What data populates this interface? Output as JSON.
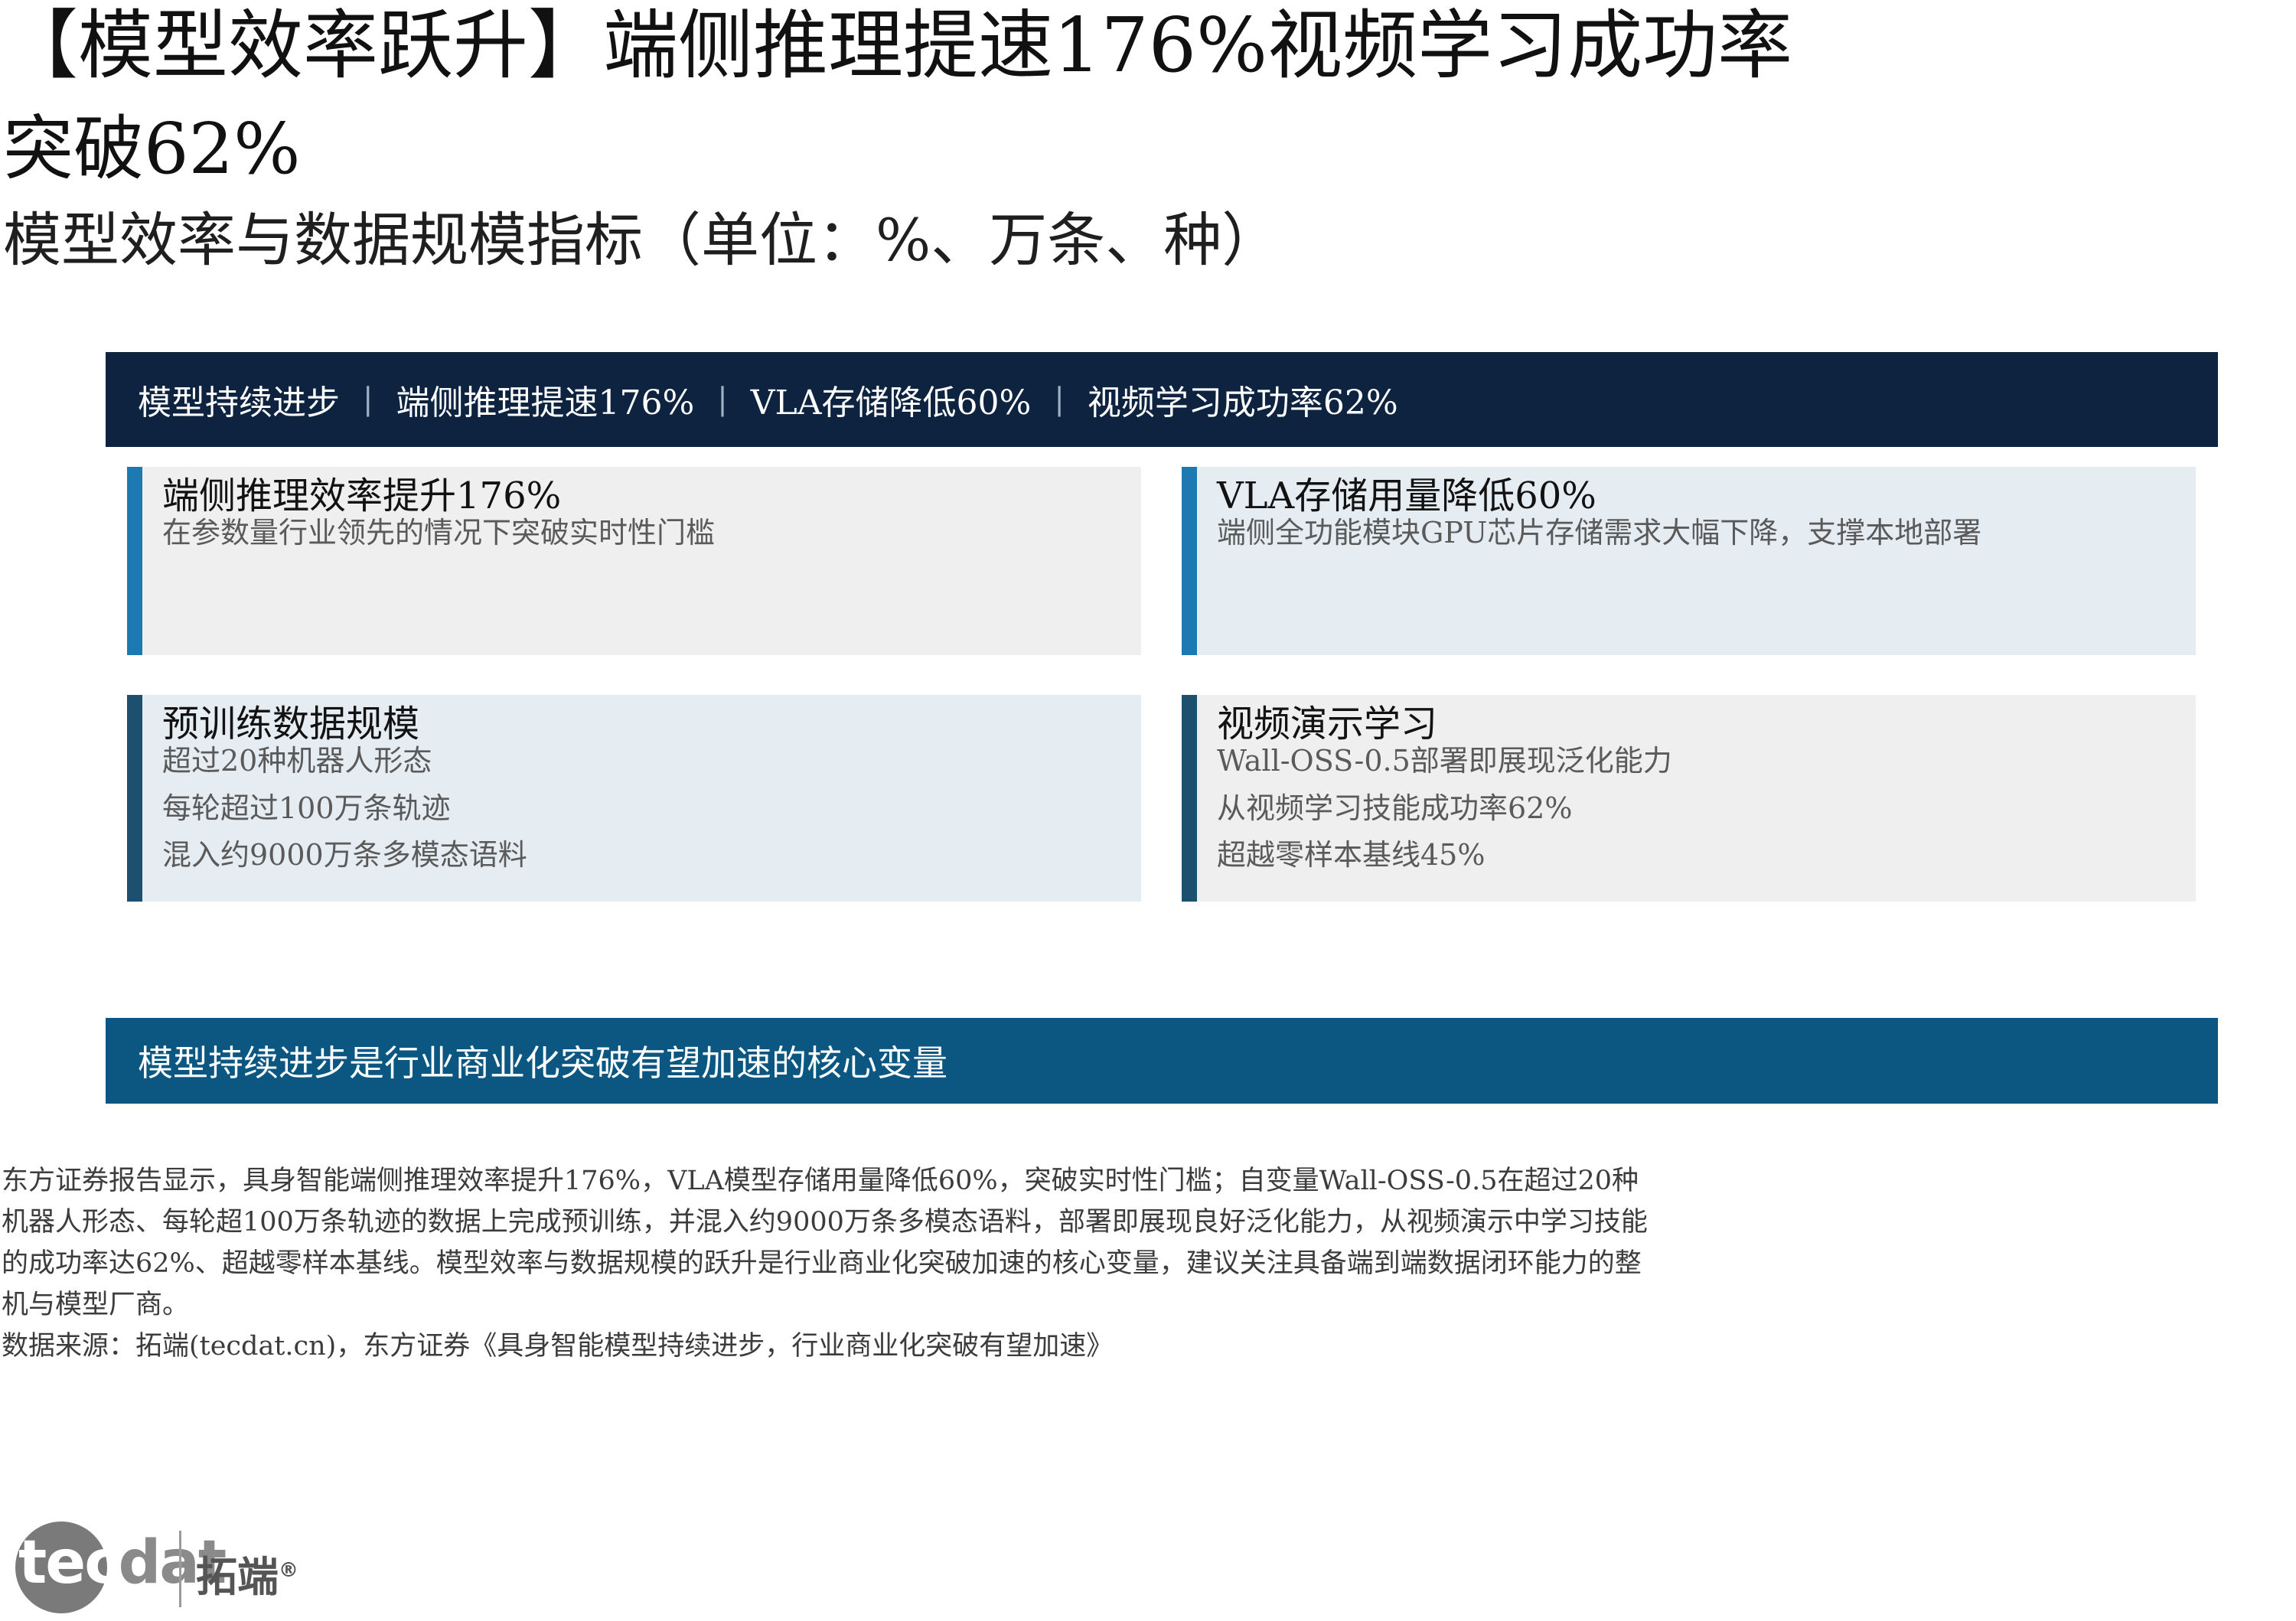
{
  "title_line1": "【模型效率跃升】端侧推理提速176%视频学习成功率",
  "title_line2": "突破62%",
  "subtitle": "模型效率与数据规模指标（单位：%、万条、种）",
  "top_banner": {
    "items": [
      "模型持续进步",
      "端侧推理提速176%",
      "VLA存储降低60%",
      "视频学习成功率62%"
    ],
    "separator": "|"
  },
  "cards": {
    "top_left": {
      "title": "端侧推理效率提升176%",
      "lines": [
        "在参数量行业领先的情况下突破实时性门槛"
      ]
    },
    "top_right": {
      "title": "VLA存储用量降低60%",
      "lines": [
        "端侧全功能模块GPU芯片存储需求大幅下降，支撑本地部署"
      ]
    },
    "bottom_left": {
      "title": "预训练数据规模",
      "lines": [
        "超过20种机器人形态",
        "每轮超过100万条轨迹",
        "混入约9000万条多模态语料"
      ]
    },
    "bottom_right": {
      "title": "视频演示学习",
      "lines": [
        "Wall-OSS-0.5部署即展现泛化能力",
        "从视频学习技能成功率62%",
        "超越零样本基线45%"
      ]
    }
  },
  "bottom_banner": "模型持续进步是行业商业化突破有望加速的核心变量",
  "body_text": "东方证券报告显示，具身智能端侧推理效率提升176%，VLA模型存储用量降低60%，突破实时性门槛；自变量Wall-OSS-0.5在超过20种机器人形态、每轮超100万条轨迹的数据上完成预训练，并混入约9000万条多模态语料，部署即展现良好泛化能力，从视频演示中学习技能的成功率达62%、超越零样本基线。模型效率与数据规模的跃升是行业商业化突破加速的核心变量，建议关注具备端到端数据闭环能力的整机与模型厂商。",
  "source_text": "数据来源：拓端(tecdat.cn)，东方证券《具身智能模型持续进步，行业商业化突破有望加速》",
  "logo": {
    "text_part1": "tec",
    "text_part2": "dat",
    "cn": "拓端",
    "mark": "®"
  },
  "colors": {
    "navy": "#0d2340",
    "blue_banner": "#0b5781",
    "accent_light": "#1c79b2",
    "accent_dark": "#1d4f6f",
    "card_gray": "#efefef",
    "card_blue": "#e6edf2"
  }
}
